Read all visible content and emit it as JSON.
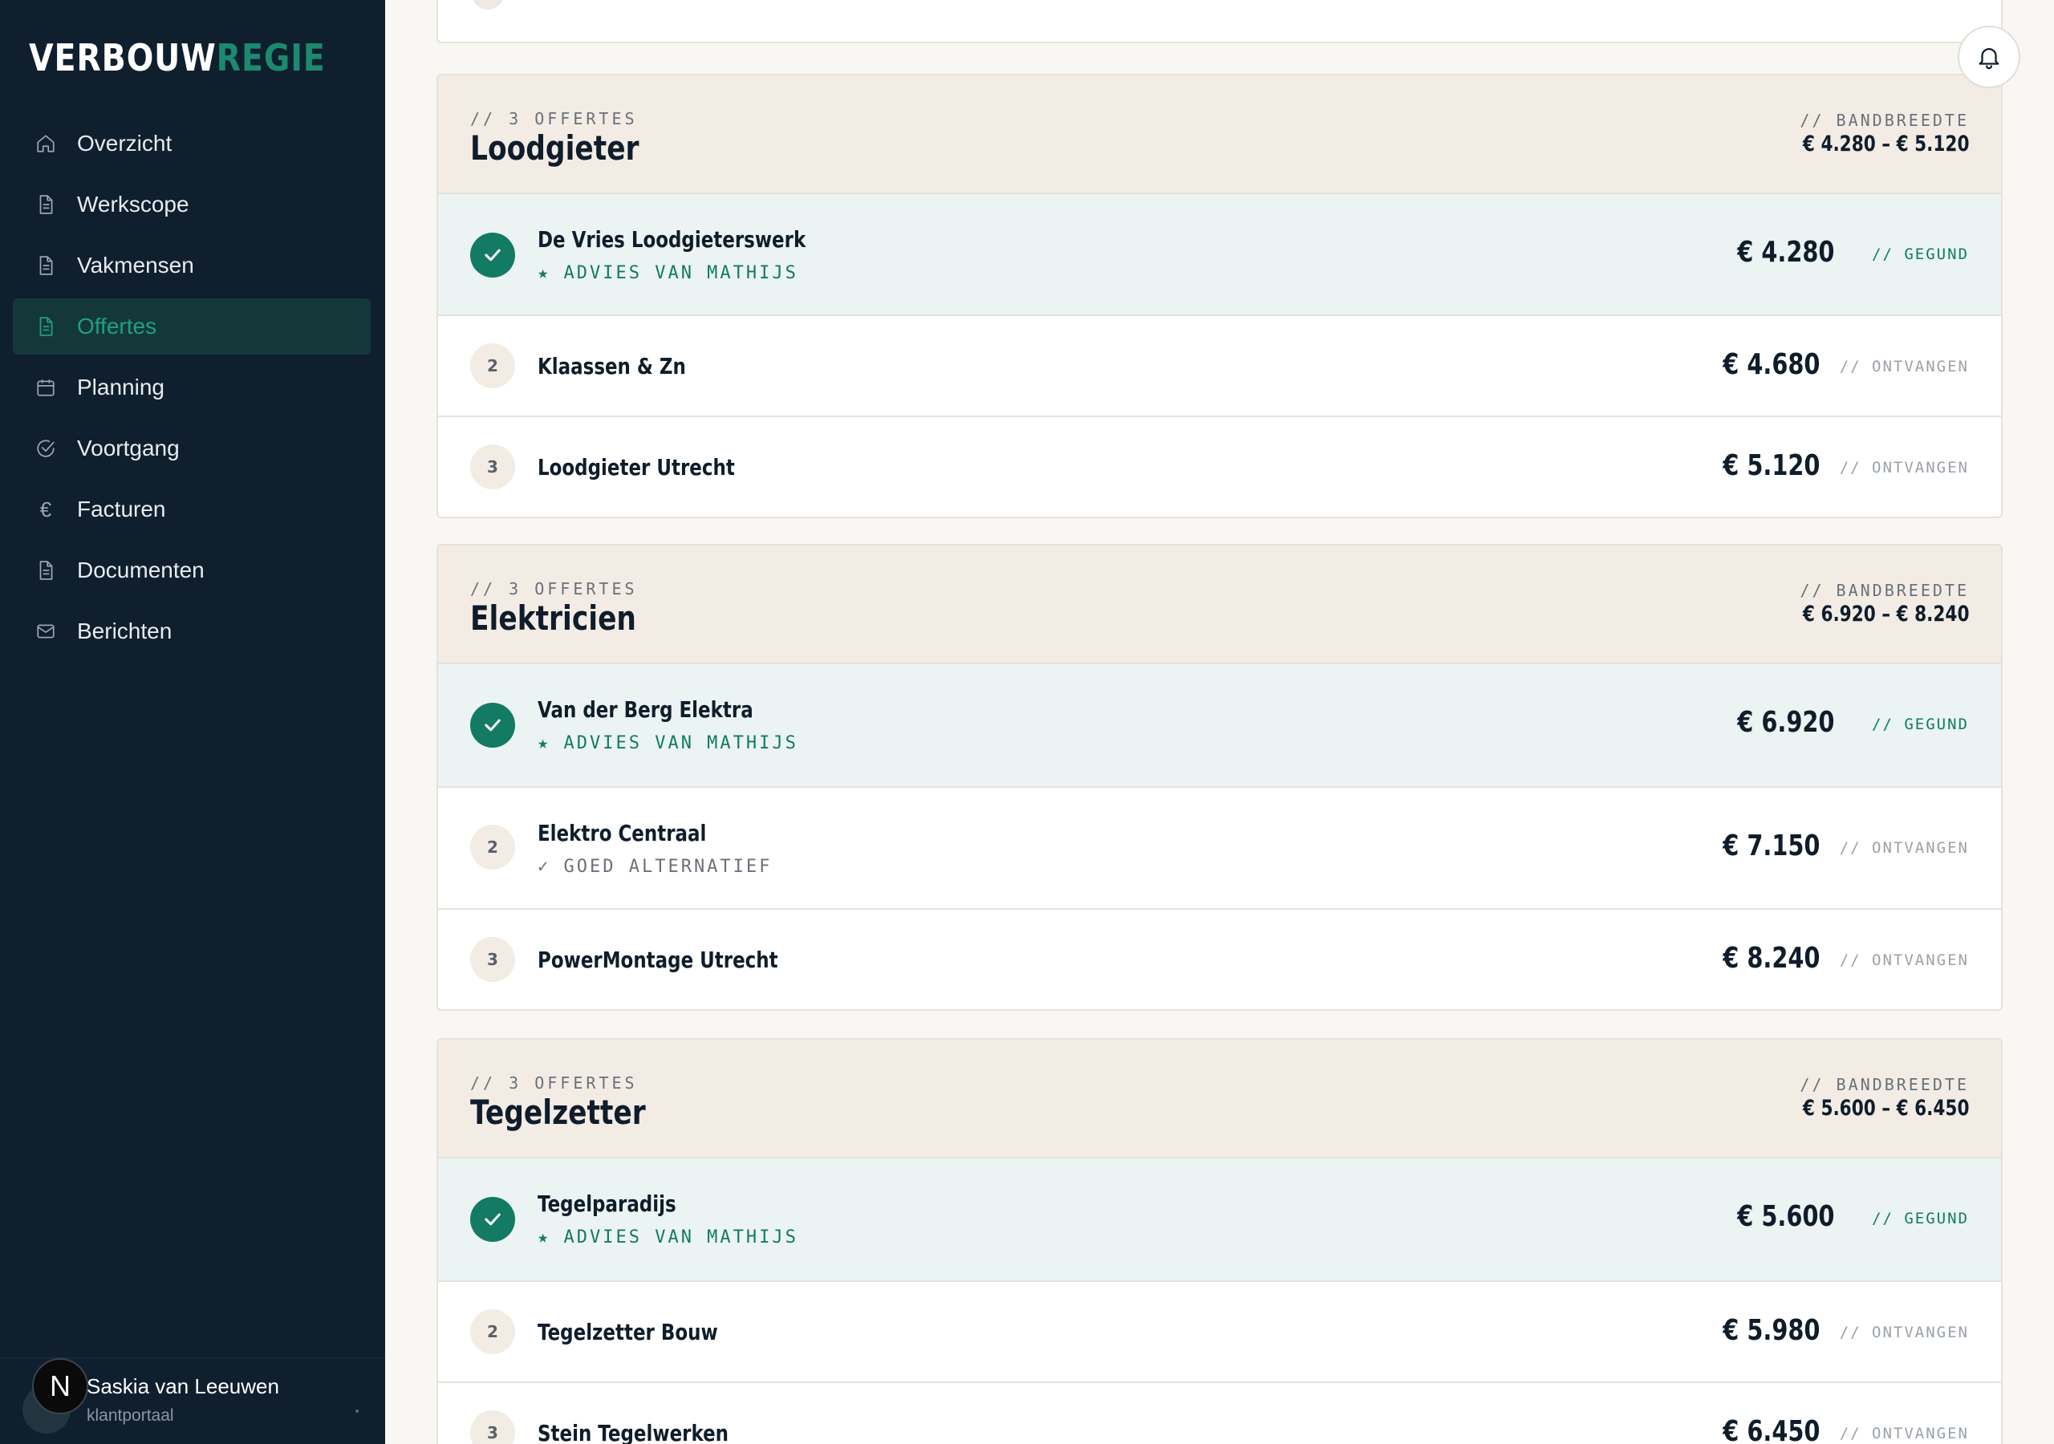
{
  "app": {
    "logo_part1": "VERBOUW",
    "logo_part2": "REGIE"
  },
  "sidebar": {
    "items": [
      {
        "label": "Overzicht",
        "icon": "home-icon",
        "active": false
      },
      {
        "label": "Werkscope",
        "icon": "document-icon",
        "active": false
      },
      {
        "label": "Vakmensen",
        "icon": "document-icon",
        "active": false
      },
      {
        "label": "Offertes",
        "icon": "document-icon",
        "active": true
      },
      {
        "label": "Planning",
        "icon": "calendar-icon",
        "active": false
      },
      {
        "label": "Voortgang",
        "icon": "check-circle-icon",
        "active": false
      },
      {
        "label": "Facturen",
        "icon": "euro-icon",
        "active": false
      },
      {
        "label": "Documenten",
        "icon": "document-icon",
        "active": false
      },
      {
        "label": "Berichten",
        "icon": "mail-icon",
        "active": false
      }
    ],
    "user": {
      "name": "Saskia van Leeuwen",
      "role": "klantportaal",
      "badge": "N"
    }
  },
  "groups": [
    {
      "count": "// 3 OFFERTES",
      "title": "Loodgieter",
      "bandwidth_label": "// BANDBREEDTE",
      "bandwidth": "€ 4.280 – € 5.120",
      "quotes": [
        {
          "rank": "",
          "name": "De Vries Loodgieterswerk",
          "note": "★ ADVIES VAN MATHIJS",
          "price": "€ 4.280",
          "status": "// GEGUND"
        },
        {
          "rank": "2",
          "name": "Klaassen & Zn",
          "note": "",
          "price": "€ 4.680",
          "status": "// ONTVANGEN"
        },
        {
          "rank": "3",
          "name": "Loodgieter Utrecht",
          "note": "",
          "price": "€ 5.120",
          "status": "// ONTVANGEN"
        }
      ]
    },
    {
      "count": "// 3 OFFERTES",
      "title": "Elektricien",
      "bandwidth_label": "// BANDBREEDTE",
      "bandwidth": "€ 6.920 – € 8.240",
      "quotes": [
        {
          "rank": "",
          "name": "Van der Berg Elektra",
          "note": "★ ADVIES VAN MATHIJS",
          "price": "€ 6.920",
          "status": "// GEGUND"
        },
        {
          "rank": "2",
          "name": "Elektro Centraal",
          "note": "✓ GOED ALTERNATIEF",
          "price": "€ 7.150",
          "status": "// ONTVANGEN"
        },
        {
          "rank": "3",
          "name": "PowerMontage Utrecht",
          "note": "",
          "price": "€ 8.240",
          "status": "// ONTVANGEN"
        }
      ]
    },
    {
      "count": "// 3 OFFERTES",
      "title": "Tegelzetter",
      "bandwidth_label": "// BANDBREEDTE",
      "bandwidth": "€ 5.600 – € 6.450",
      "quotes": [
        {
          "rank": "",
          "name": "Tegelparadijs",
          "note": "★ ADVIES VAN MATHIJS",
          "price": "€ 5.600",
          "status": "// GEGUND"
        },
        {
          "rank": "2",
          "name": "Tegelzetter Bouw",
          "note": "",
          "price": "€ 5.980",
          "status": "// ONTVANGEN"
        },
        {
          "rank": "3",
          "name": "Stein Tegelwerken",
          "note": "",
          "price": "€ 6.450",
          "status": "// ONTVANGEN"
        }
      ]
    }
  ],
  "colors": {
    "sidebar_bg": "#0f1f2e",
    "accent": "#137a63",
    "header_bg": "#f2ece5",
    "won_bg": "#ebf4f2"
  }
}
